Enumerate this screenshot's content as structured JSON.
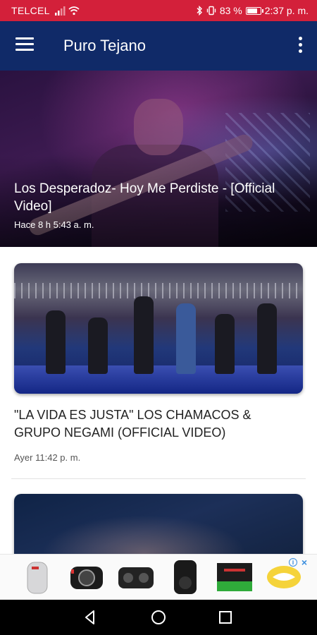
{
  "status_bar": {
    "carrier": "TELCEL",
    "battery": "83 %",
    "battery_level": 0.83,
    "time": "2:37 p. m."
  },
  "app_bar": {
    "title": "Puro Tejano"
  },
  "featured": {
    "title": "Los Desperadoz- Hoy Me Perdiste - [Official Video]",
    "time": "Hace 8 h 5:43 a. m."
  },
  "feed": [
    {
      "title": "\"LA VIDA ES JUSTA\" LOS CHAMACOS & GRUPO NEGAMI (OFFICIAL VIDEO)",
      "time": "Ayer 11:42 p. m."
    }
  ],
  "ad": {
    "items": [
      "speaker-product",
      "camera-product",
      "boombox-product",
      "party-speaker-product",
      "ssd-product",
      "handshake-logo"
    ],
    "badge_info": "i",
    "badge_close": "×"
  },
  "colors": {
    "status_bar": "#d3203a",
    "app_bar": "#102a68",
    "nav_bar": "#000000"
  }
}
